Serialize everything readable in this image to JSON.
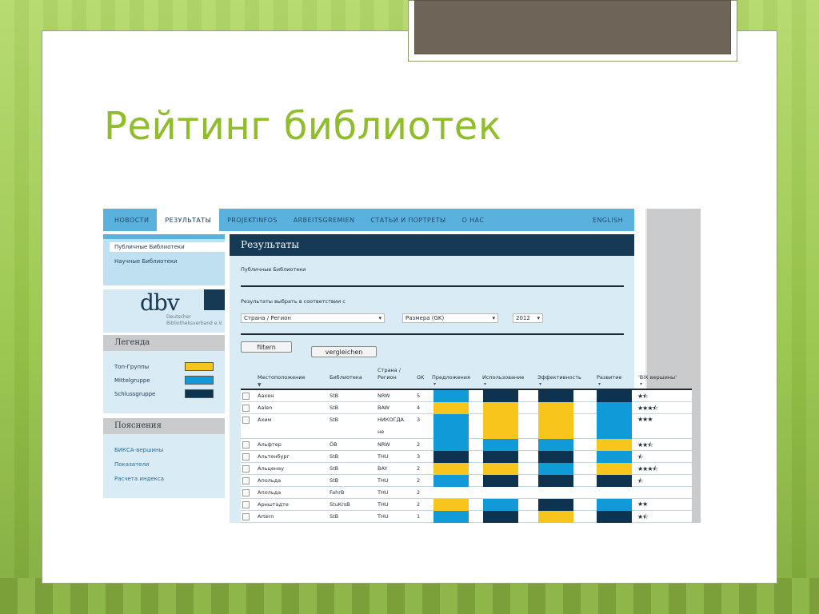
{
  "slide": {
    "title": "Рейтинг библиотек"
  },
  "colors": {
    "top": "#f8c51c",
    "mittel": "#119ad8",
    "schluss": "#0e3350",
    "title_green": "#8fbd2c"
  },
  "nav": {
    "items": [
      "НОВОСТИ",
      "РЕЗУЛЬТАТЫ",
      "PROJEKTINFOS",
      "ARBEITSGREMIEN",
      "СТАТЬИ И ПОРТРЕТЫ",
      "О НАС"
    ],
    "active": "РЕЗУЛЬТАТЫ",
    "lang": "ENGLISH"
  },
  "sidebar": {
    "links": [
      "Публичные Библиотеки",
      "Научные Библиотеки"
    ],
    "logo": {
      "text": "dbv",
      "sub1": "Deutscher",
      "sub2": "Bibliotheksverband e.V."
    },
    "legend": {
      "title": "Легенда",
      "items": [
        {
          "label": "Топ-Группы",
          "color": "#f8c51c"
        },
        {
          "label": "Mittelgruppe",
          "color": "#119ad8"
        },
        {
          "label": "Schlussgruppe",
          "color": "#0e3350"
        }
      ]
    },
    "explanations": {
      "title": "Пояснения",
      "links": [
        "БИКСА-вершины",
        "Показатели",
        "Расчета индекса"
      ]
    }
  },
  "main": {
    "title": "Результаты",
    "subtitle": "Публичные Библиотеки",
    "filter_label": "Результаты выбрать в соответствии с",
    "select_region": "Страна / Регион",
    "select_size": "Размера (GK)",
    "select_year": "2012",
    "filter_button": "filtern",
    "compare_button": "vergleichen",
    "columns": {
      "location": "Местоположение",
      "library": "Библиотека",
      "region1": "Страна /",
      "region2": "Регион",
      "gk": "GK",
      "offers": "Предложения",
      "usage": "Использование",
      "efficiency": "Эффективность",
      "development": "Развитие",
      "bix": "'BIX вершины'"
    },
    "rows": [
      {
        "location": "Аахен",
        "library": "StB",
        "region": "NRW",
        "region2": "",
        "gk": "5",
        "stars": "★⯪"
      },
      {
        "location": "Aalen",
        "library": "StB",
        "region": "BAW",
        "region2": "",
        "gk": "4",
        "stars": "★★★⯪"
      },
      {
        "location": "Ахим",
        "library": "StB",
        "region": "НИКОГДА",
        "region2": "не",
        "gk": "3",
        "stars": "★★★"
      },
      {
        "location": "Альфтер",
        "library": "ÖB",
        "region": "NRW",
        "region2": "",
        "gk": "2",
        "stars": "★★⯪"
      },
      {
        "location": "Альтенбург",
        "library": "StB",
        "region": "THU",
        "region2": "",
        "gk": "3",
        "stars": "⯪"
      },
      {
        "location": "Альценау",
        "library": "StB",
        "region": "BAY",
        "region2": "",
        "gk": "2",
        "stars": "★★★⯪"
      },
      {
        "location": "Апольда",
        "library": "StB",
        "region": "THU",
        "region2": "",
        "gk": "2",
        "stars": "⯪"
      },
      {
        "location": "Апольда",
        "library": "FahrB",
        "region": "THU",
        "region2": "",
        "gk": "2",
        "stars": ""
      },
      {
        "location": "Арнштадте",
        "library": "StuKrsB",
        "region": "THU",
        "region2": "",
        "gk": "2",
        "stars": "★★"
      },
      {
        "location": "Artern",
        "library": "StB",
        "region": "THU",
        "region2": "",
        "gk": "1",
        "stars": "★⯪"
      }
    ],
    "row_groups": [
      [
        "mittel",
        "schluss",
        "schluss",
        "schluss"
      ],
      [
        "top",
        "top",
        "top",
        "mittel"
      ],
      [
        "mittel",
        "top",
        "top",
        "mittel"
      ],
      [
        "mittel",
        "mittel",
        "mittel",
        "top"
      ],
      [
        "schluss",
        "schluss",
        "schluss",
        "mittel"
      ],
      [
        "top",
        "top",
        "mittel",
        "top"
      ],
      [
        "mittel",
        "schluss",
        "schluss",
        "schluss"
      ],
      [
        "",
        "",
        "",
        ""
      ],
      [
        "top",
        "mittel",
        "schluss",
        "mittel"
      ],
      [
        "mittel",
        "schluss",
        "top",
        "schluss"
      ]
    ]
  }
}
